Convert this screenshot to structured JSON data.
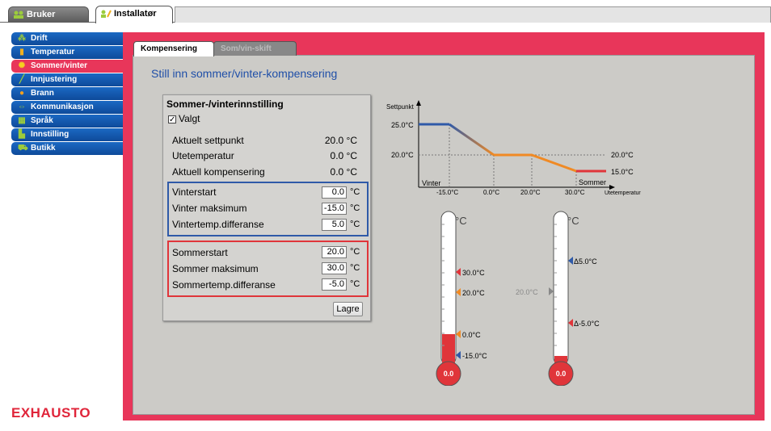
{
  "top_tabs": [
    "Bruker",
    "Installatør"
  ],
  "sidebar": {
    "items": [
      {
        "label": "Drift",
        "icon": "sliders-icon",
        "active": false
      },
      {
        "label": "Temperatur",
        "icon": "thermometer-icon",
        "active": false
      },
      {
        "label": "Sommer/vinter",
        "icon": "sun-icon",
        "active": true
      },
      {
        "label": "Innjustering",
        "icon": "pencil-icon",
        "active": false
      },
      {
        "label": "Brann",
        "icon": "fire-icon",
        "active": false
      },
      {
        "label": "Kommunikasjon",
        "icon": "network-icon",
        "active": false
      },
      {
        "label": "Språk",
        "icon": "grid-icon",
        "active": false
      },
      {
        "label": "Innstilling",
        "icon": "chart-icon",
        "active": false
      },
      {
        "label": "Butikk",
        "icon": "cart-icon",
        "active": false
      }
    ]
  },
  "logo": "EXHAUSTO",
  "sub_tabs": [
    "Kompensering",
    "Som/vin-skift"
  ],
  "heading": "Still inn sommer/vinter-kompensering",
  "settings": {
    "title": "Sommer-/vinterinnstilling",
    "checkbox_label": "Valgt",
    "checked": true,
    "readouts": [
      {
        "label": "Aktuelt settpunkt",
        "value": "20.0 °C"
      },
      {
        "label": "Utetemperatur",
        "value": "0.0 °C"
      },
      {
        "label": "Aktuell kompensering",
        "value": "0.0 °C"
      }
    ],
    "winter": [
      {
        "label": "Vinterstart",
        "value": "0.0",
        "unit": "°C"
      },
      {
        "label": "Vinter maksimum",
        "value": "-15.0",
        "unit": "°C"
      },
      {
        "label": "Vintertemp.differanse",
        "value": "5.0",
        "unit": "°C"
      }
    ],
    "summer": [
      {
        "label": "Sommerstart",
        "value": "20.0",
        "unit": "°C"
      },
      {
        "label": "Sommer maksimum",
        "value": "30.0",
        "unit": "°C"
      },
      {
        "label": "Sommertemp.differanse",
        "value": "-5.0",
        "unit": "°C"
      }
    ],
    "save_label": "Lagre"
  },
  "graph": {
    "ylabel": "Settpunkt",
    "xlabel": "Utetemperatur",
    "winter_label": "Vinter",
    "summer_label": "Sommer",
    "y_ticks": [
      "25.0°C",
      "20.0°C"
    ],
    "right_labels": [
      "20.0°C",
      "15.0°C"
    ],
    "x_ticks": [
      "-15.0°C",
      "0.0°C",
      "20.0°C",
      "30.0°C"
    ]
  },
  "thermo1": {
    "unit": "°C",
    "bulb_value": "0.0",
    "markers": [
      {
        "label": "30.0°C",
        "color": "#e0353a"
      },
      {
        "label": "20.0°C",
        "color": "#f08a24"
      },
      {
        "label": "0.0°C",
        "color": "#f08a24"
      },
      {
        "label": "-15.0°C",
        "color": "#2f5aa8"
      }
    ]
  },
  "thermo2": {
    "unit": "°C",
    "bulb_value": "0.0",
    "markers": [
      {
        "label": "Δ5.0°C",
        "color": "#2f5aa8"
      },
      {
        "label": "20.0°C",
        "color": "#888888"
      },
      {
        "label": "Δ-5.0°C",
        "color": "#e0353a"
      }
    ]
  }
}
